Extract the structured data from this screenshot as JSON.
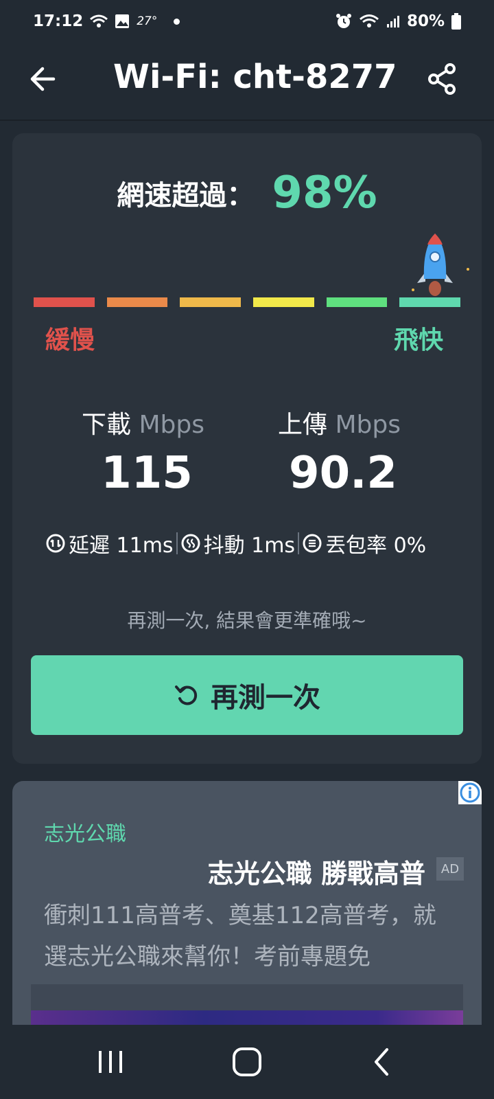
{
  "status_bar": {
    "time": "17:12",
    "temperature": "27°",
    "battery": "80%",
    "icons": [
      "wifi-icon",
      "image-icon",
      "alarm-icon",
      "wifi-signal-icon",
      "cell-signal-icon",
      "battery-icon"
    ]
  },
  "header": {
    "title": "Wi-Fi: cht-8277",
    "back_icon": "arrow-left-icon",
    "share_icon": "share-icon"
  },
  "result": {
    "speed_label": "網速超過：",
    "speed_percent": "98%",
    "percentile": 98,
    "meter_colors": [
      "#e0524c",
      "#ea8a4a",
      "#efb94a",
      "#f2e94a",
      "#5fe07f",
      "#5fd8ae"
    ],
    "slow_label": "緩慢",
    "fast_label": "飛快",
    "download": {
      "label": "下載",
      "unit": "Mbps",
      "value": "115"
    },
    "upload": {
      "label": "上傳",
      "unit": "Mbps",
      "value": "90.2"
    },
    "stats": [
      {
        "icon": "latency-icon",
        "text": "延遲 11ms"
      },
      {
        "icon": "jitter-icon",
        "text": "抖動 1ms"
      },
      {
        "icon": "packet-loss-icon",
        "text": "丟包率 0%"
      }
    ],
    "hint": "再測一次, 結果會更準確哦~",
    "retest_label": "再測一次"
  },
  "ad": {
    "brand": "志光公職",
    "headline": "志光公職 勝戰高普",
    "badge": "AD",
    "body": "衝刺111高普考、奠基112高普考，就選志光公職來幫你！考前專題免"
  },
  "colors": {
    "background": "#222a33",
    "card": "#2b333c",
    "accent": "#5fd8ae",
    "button": "#62d6b0"
  }
}
